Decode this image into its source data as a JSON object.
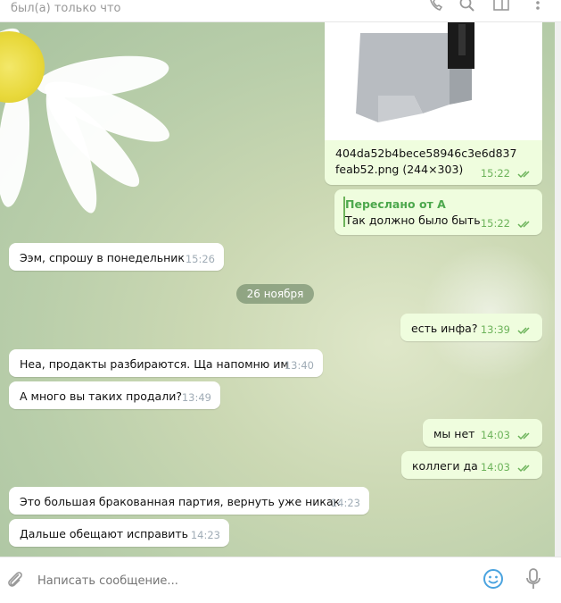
{
  "header": {
    "status": "был(а) только что"
  },
  "attachment": {
    "filename": "404da52b4bece58946c3e6d837feab52.png (244×303)",
    "time": "15:22"
  },
  "forwarded": {
    "title": "Переслано от А",
    "text": "Так должно было быть",
    "time": "15:22"
  },
  "date_divider": "26 ноября",
  "messages": [
    {
      "text": "Ээм, спрошу в понедельник",
      "time": "15:26"
    },
    {
      "text": "есть инфа?",
      "time": "13:39"
    },
    {
      "text": "Неа, продакты разбираются. Ща напомню им",
      "time": "13:40"
    },
    {
      "text": "А много вы таких продали?",
      "time": "13:49"
    },
    {
      "text": "мы нет",
      "time": "14:03"
    },
    {
      "text": "коллеги да",
      "time": "14:03"
    },
    {
      "text": "Это большая бракованная партия, вернуть уже никак",
      "time": "14:23"
    },
    {
      "text": "Дальше обещают исправить",
      "time": "14:23"
    }
  ],
  "composer": {
    "placeholder": "Написать сообщение..."
  },
  "icons": [
    "phone-icon",
    "search-icon",
    "columns-icon",
    "more-icon",
    "attach-icon",
    "emoji-icon",
    "microphone-icon"
  ],
  "colors": {
    "outgoing": "#effdde",
    "incoming": "#ffffff",
    "checks": "#6cb35a",
    "accent": "#4aa3df"
  }
}
